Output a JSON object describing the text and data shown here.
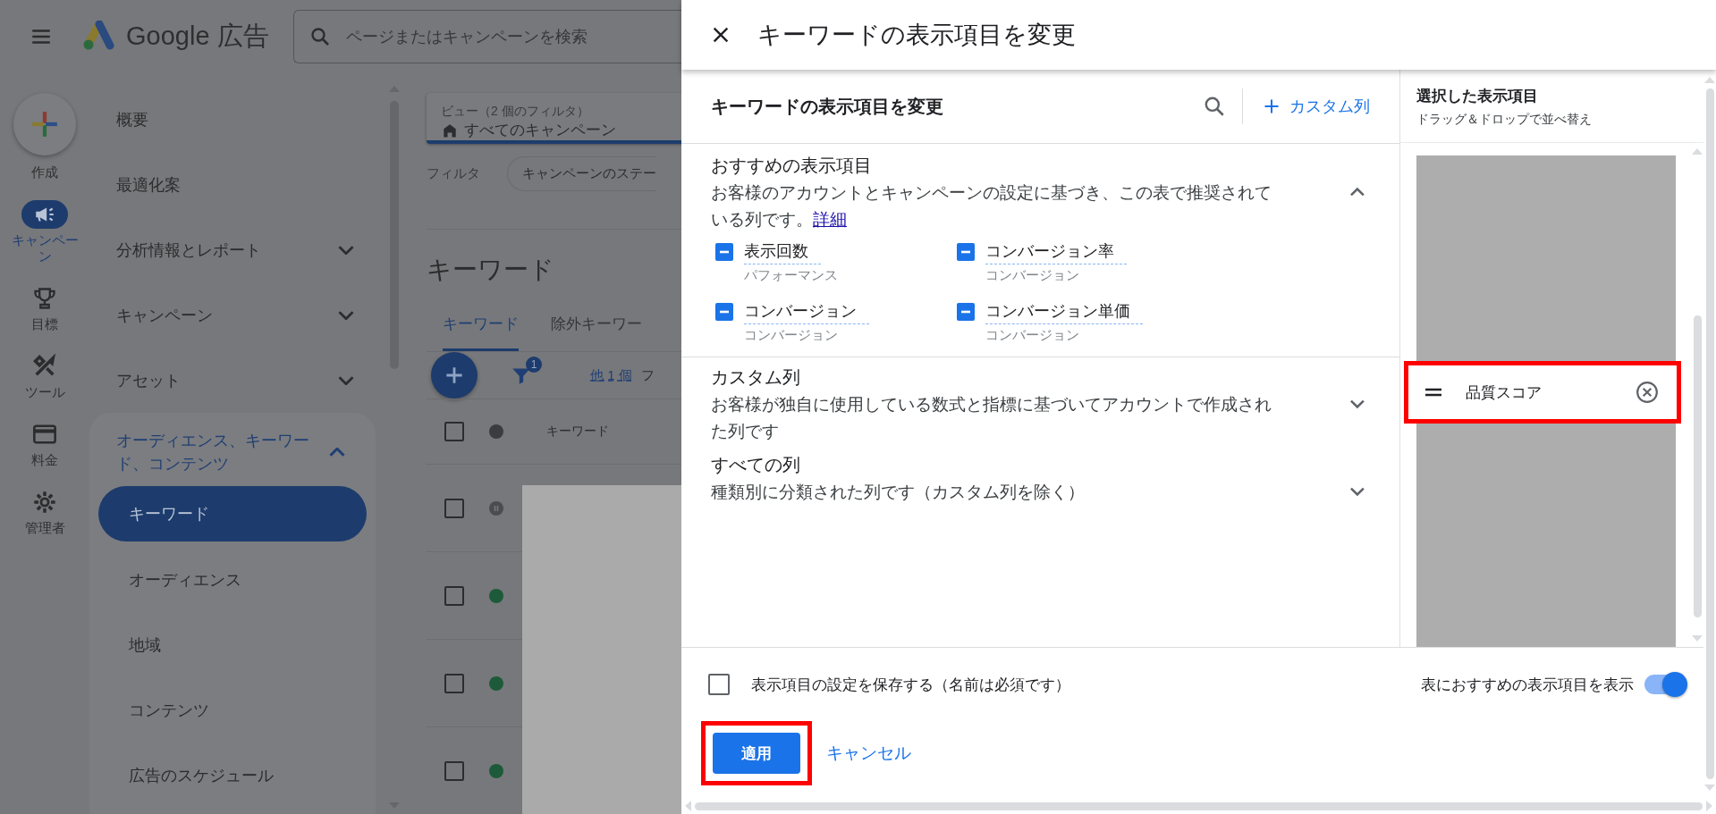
{
  "app": {
    "product": "Google 広告",
    "search": {
      "placeholder": "ページまたはキャンペーンを検索"
    }
  },
  "rail": [
    {
      "kind": "create",
      "label": "作成",
      "selected": false
    },
    {
      "kind": "campaigns",
      "label": "キャンペーン",
      "selected": true
    },
    {
      "kind": "goals",
      "label": "目標",
      "selected": false
    },
    {
      "kind": "tools",
      "label": "ツール",
      "selected": false
    },
    {
      "kind": "billing",
      "label": "料金",
      "selected": false
    },
    {
      "kind": "admin",
      "label": "管理者",
      "selected": false
    }
  ],
  "nav": [
    {
      "label": "概要",
      "kind": "link"
    },
    {
      "label": "最適化案",
      "kind": "link"
    },
    {
      "label": "分析情報とレポート",
      "kind": "group",
      "expanded": false
    },
    {
      "label": "キャンペーン",
      "kind": "group",
      "expanded": false
    },
    {
      "label": "アセット",
      "kind": "group",
      "expanded": false
    },
    {
      "label": "オーディエンス、キーワード、コンテンツ",
      "kind": "group",
      "expanded": true,
      "children": [
        {
          "label": "キーワード",
          "selected": true
        },
        {
          "label": "オーディエンス",
          "selected": false
        },
        {
          "label": "地域",
          "selected": false
        },
        {
          "label": "コンテンツ",
          "selected": false
        },
        {
          "label": "広告のスケジュール",
          "selected": false
        }
      ]
    }
  ],
  "main": {
    "view": {
      "label": "ビュー（2 個のフィルタ）",
      "value": "すべてのキャンペーン"
    },
    "filter": {
      "label": "フィルタ",
      "chip": "キャンペーンのステー"
    },
    "title": "キーワード",
    "tabs": [
      {
        "label": "キーワード",
        "selected": true
      },
      {
        "label": "除外キーワー",
        "selected": false
      }
    ],
    "toolbar": {
      "filter_badge": "1",
      "more_link": "他 1 個",
      "cut_text": "フ"
    },
    "table": {
      "header": {
        "label": "キーワード",
        "color": "#3b3c3f",
        "checked": false
      },
      "rows": [
        {
          "kind": "paused",
          "color": "#4b4c4f",
          "checked": false
        },
        {
          "kind": "enabled",
          "color": "#1d5a3a",
          "checked": false
        },
        {
          "kind": "enabled",
          "color": "#1d5a3a",
          "checked": false
        },
        {
          "kind": "enabled",
          "color": "#1d5a3a",
          "checked": false
        }
      ]
    }
  },
  "panel": {
    "title": "キーワードの表示項目を変更",
    "heading": "キーワードの表示項目を変更",
    "custom_column_button": "カスタム列",
    "sections": [
      {
        "title": "おすすめの表示項目",
        "description": "お客様のアカウントとキャンペーンの設定に基づき、この表で推奨されている列です。",
        "link": "詳細",
        "expanded": true,
        "columns": [
          {
            "label": "表示回数",
            "category": "パフォーマンス",
            "checked": true
          },
          {
            "label": "コンバージョン率",
            "category": "コンバージョン",
            "checked": true
          },
          {
            "label": "コンバージョン",
            "category": "コンバージョン",
            "checked": true
          },
          {
            "label": "コンバージョン単価",
            "category": "コンバージョン",
            "checked": true
          }
        ]
      },
      {
        "title": "カスタム列",
        "description": "お客様が独自に使用している数式と指標に基づいてアカウントで作成された列です",
        "expanded": false
      },
      {
        "title": "すべての列",
        "description": "種類別に分類された列です（カスタム列を除く）",
        "expanded": false
      }
    ],
    "selected": {
      "title": "選択した表示項目",
      "hint": "ドラッグ＆ドロップで並べ替え",
      "items": [
        {
          "label": "品質スコア"
        }
      ]
    },
    "footer": {
      "save": {
        "label": "表示項目の設定を保存する（名前は必須です）",
        "checked": false
      },
      "recommend_toggle": {
        "label": "表におすすめの表示項目を表示",
        "on": true
      },
      "apply": "適用",
      "cancel": "キャンセル"
    }
  }
}
